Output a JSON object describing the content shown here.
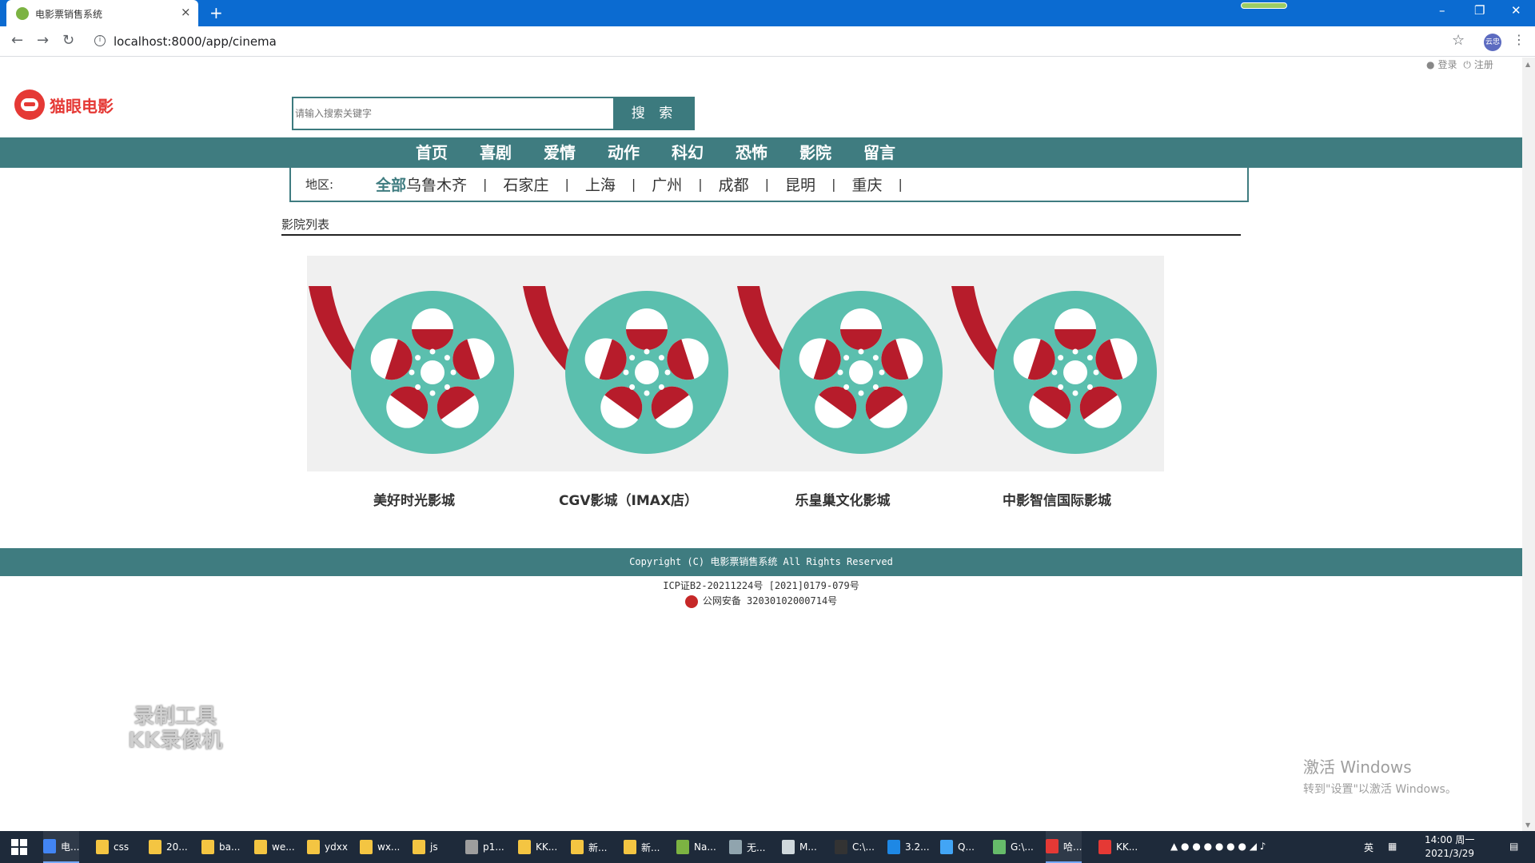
{
  "browser": {
    "tab_title": "电影票销售系统",
    "tab_close": "×",
    "new_tab": "+",
    "url": "localhost:8000/app/cinema",
    "profile": "云忠",
    "window_min": "–",
    "window_restore": "❐",
    "window_close": "✕"
  },
  "header": {
    "auth_login": "登录",
    "auth_register": "注册",
    "logo_text": "猫眼电影",
    "search_placeholder": "请输入搜索关键字",
    "search_button": "搜 索"
  },
  "nav": {
    "items": [
      "首页",
      "喜剧",
      "爱情",
      "动作",
      "科幻",
      "恐怖",
      "影院",
      "留言"
    ]
  },
  "region": {
    "label": "地区:",
    "items": [
      "全部",
      "乌鲁木齐",
      "石家庄",
      "上海",
      "广州",
      "成都",
      "昆明",
      "重庆"
    ],
    "active": "全部"
  },
  "section": {
    "title": "影院列表"
  },
  "cinemas": [
    {
      "name": "美好时光影城"
    },
    {
      "name": "CGV影城（IMAX店）"
    },
    {
      "name": "乐皇巢文化影城"
    },
    {
      "name": "中影智信国际影城"
    }
  ],
  "footer": {
    "copyright": "Copyright (C) 电影票销售系统 All Rights Reserved",
    "icp": "ICP证B2-20211224号 [2021]0179-079号",
    "police": "公网安备 32030102000714号"
  },
  "overlay": {
    "recorder_line1": "录制工具",
    "recorder_line2": "KK录像机",
    "activate_title": "激活 Windows",
    "activate_sub": "转到\"设置\"以激活 Windows。"
  },
  "taskbar": {
    "items": [
      "电...",
      "css",
      "20...",
      "ba...",
      "we...",
      "ydxx",
      "wx...",
      "js",
      "p1...",
      "KK...",
      "新...",
      "新...",
      "Na...",
      "无...",
      "M...",
      "C:\\...",
      "3.2...",
      "Q...",
      "G:\\...",
      "哈...",
      "KK..."
    ],
    "ime": "英",
    "time": "14:00 周一",
    "date": "2021/3/29"
  },
  "colors": {
    "brand_teal": "#3f7c80",
    "logo_red": "#e53935",
    "reel_teal": "#5bbfae",
    "reel_red": "#b71c2b"
  }
}
